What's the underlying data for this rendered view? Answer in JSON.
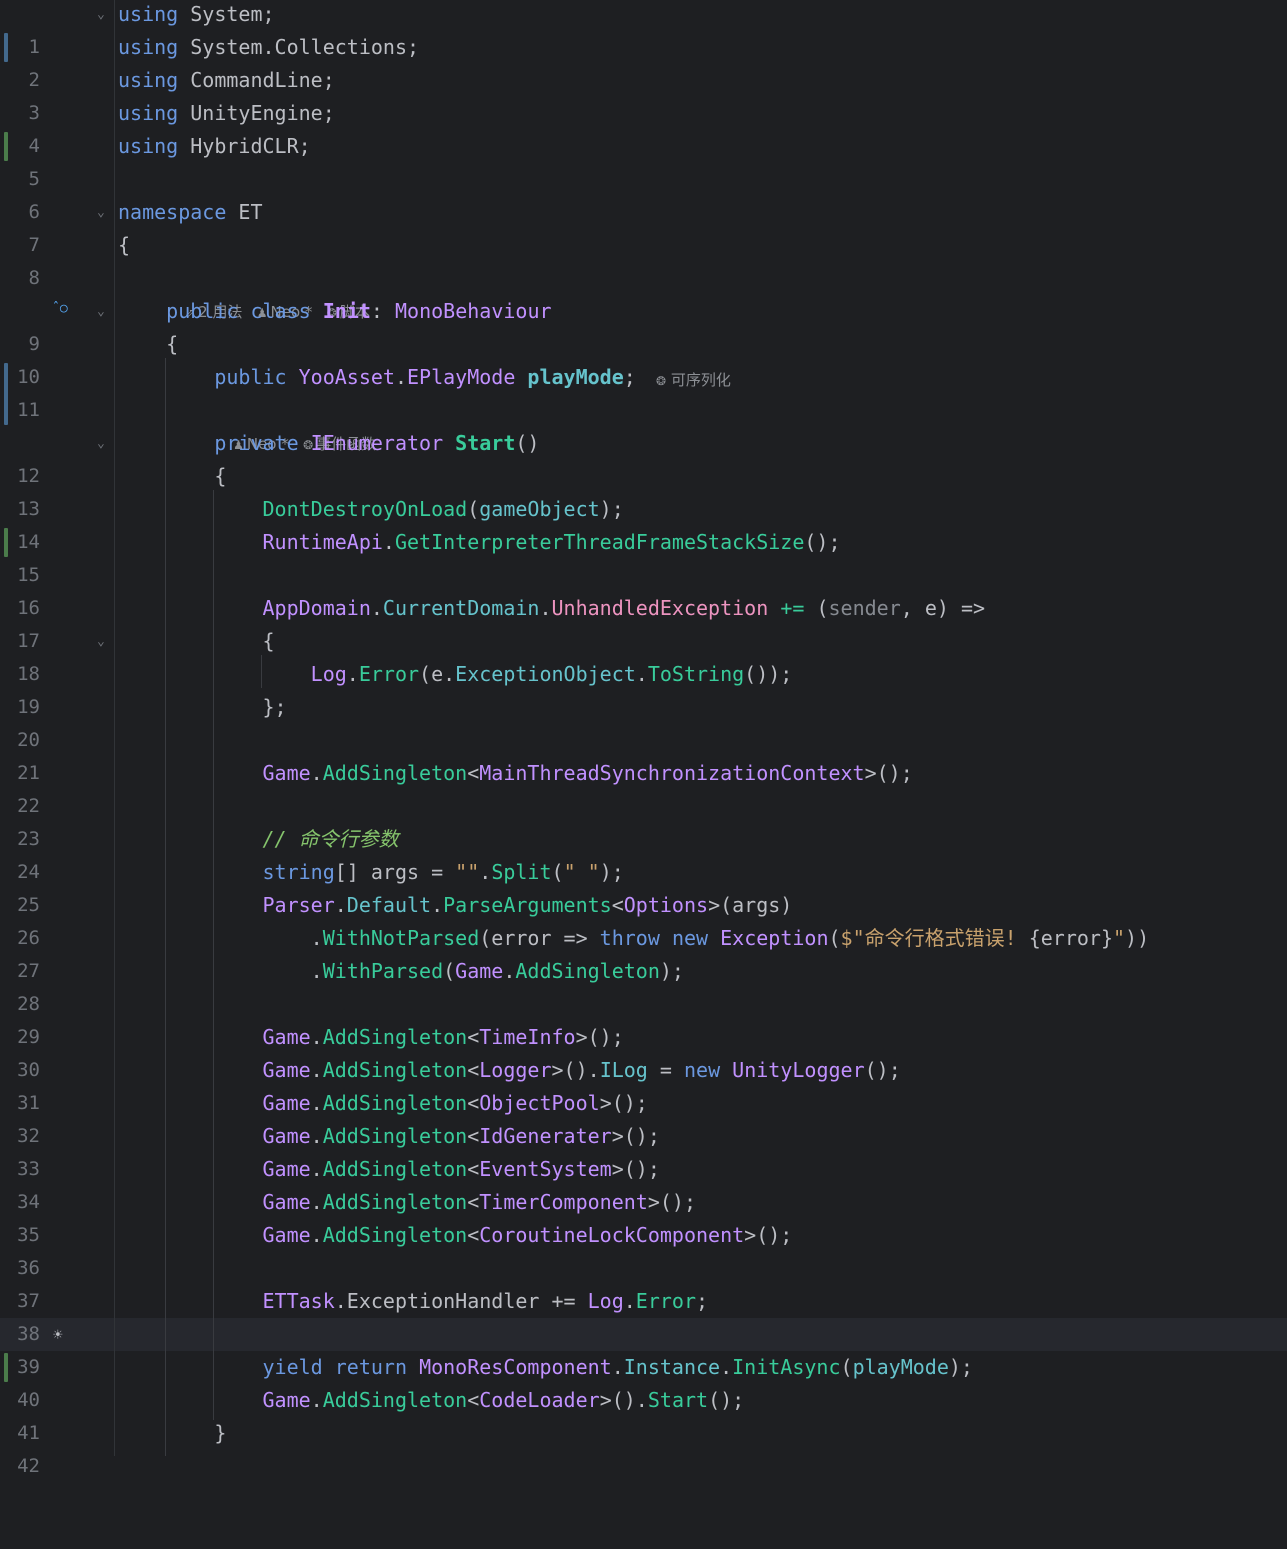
{
  "editor": {
    "language": "C#",
    "current_line": 39,
    "colors": {
      "background": "#1e1f22",
      "keyword": "#6b98e0",
      "type": "#c191ff",
      "method": "#39cc9b",
      "string": "#c9a26d",
      "comment": "#85c46c",
      "line_number": "#6f737a",
      "vcs_modified": "#43698d",
      "vcs_added": "#4b7c4b"
    },
    "line_numbers": [
      "1",
      "2",
      "3",
      "4",
      "5",
      "6",
      "7",
      "8",
      "9",
      "10",
      "11",
      "12",
      "13",
      "14",
      "15",
      "16",
      "17",
      "18",
      "19",
      "20",
      "21",
      "22",
      "23",
      "24",
      "25",
      "26",
      "27",
      "28",
      "29",
      "30",
      "31",
      "32",
      "33",
      "34",
      "35",
      "36",
      "37",
      "38",
      "39",
      "40",
      "41",
      "42"
    ],
    "hints": {
      "class_usages": "2 用法",
      "class_author": "Neo *",
      "class_unity": "脚本",
      "field_serializable": "可序列化",
      "method_author": "Neo *",
      "method_unity": "事件函数"
    },
    "gutter_icons": [
      "override-icon",
      "bulb-icon"
    ]
  }
}
